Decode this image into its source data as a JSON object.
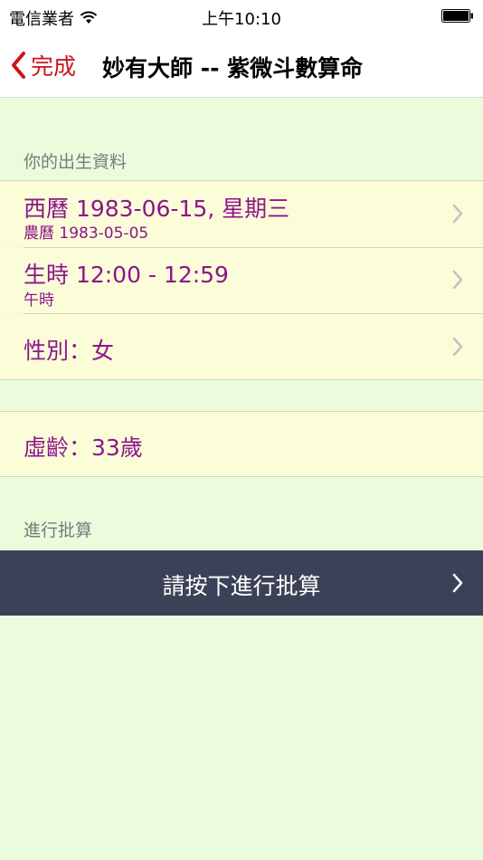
{
  "status_bar": {
    "carrier": "電信業者",
    "time": "上午10:10"
  },
  "nav": {
    "back_label": "完成",
    "title": "妙有大師 -- 紫微斗數算命"
  },
  "birth_section": {
    "header": "你的出生資料",
    "rows": [
      {
        "main": "西曆 1983-06-15, 星期三",
        "sub": "農曆 1983-05-05"
      },
      {
        "main": "生時 12:00 - 12:59",
        "sub": "午時"
      },
      {
        "main": "性別：女"
      }
    ]
  },
  "age_row": {
    "label": "虛齡：33歲"
  },
  "action_section": {
    "header": "進行批算",
    "button_label": "請按下進行批算"
  }
}
